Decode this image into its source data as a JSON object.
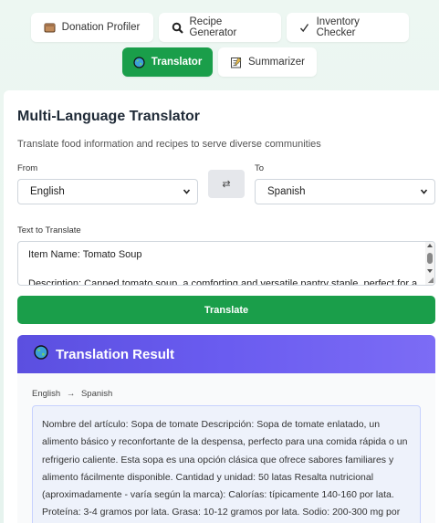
{
  "nav": {
    "tabs": [
      {
        "label": "Donation Profiler",
        "icon": "box-icon",
        "active": false
      },
      {
        "label": "Recipe Generator",
        "icon": "search-icon",
        "active": false
      },
      {
        "label": "Inventory Checker",
        "icon": "checkmark-icon",
        "active": false
      },
      {
        "label": "Translator",
        "icon": "globe-icon",
        "active": true
      },
      {
        "label": "Summarizer",
        "icon": "memo-icon",
        "active": false
      }
    ]
  },
  "card": {
    "title": "Multi-Language Translator",
    "subtitle": "Translate food information and recipes to serve diverse communities",
    "from_label": "From",
    "from_value": "English",
    "to_label": "To",
    "to_value": "Spanish",
    "swap_symbol": "⇄",
    "text_label": "Text to Translate",
    "input_line1": "Item Name: Tomato Soup",
    "input_line2": "Description: Canned tomato soup, a comforting and versatile pantry staple, perfect for a",
    "translate_button": "Translate"
  },
  "result": {
    "title": "Translation Result",
    "source_lang": "English",
    "arrow": "→",
    "target_lang": "Spanish",
    "text": "Nombre del artículo: Sopa de tomate Descripción: Sopa de tomate enlatado, un alimento básico y reconfortante de la despensa, perfecto para una comida rápida o un refrigerio caliente. Esta sopa es una opción clásica que ofrece sabores familiares y alimento fácilmente disponible. Cantidad y unidad: 50 latas Resalta nutricional (aproximadamente - varía según la marca): Calorías: típicamente 140-160 por lata. Proteína: 3-4 gramos por lata. Grasa: 10-12 gramos por lata. Sodio: 200-300 mg por"
  },
  "colors": {
    "accent_green": "#1a9e4a",
    "result_header": "#6a5cf0"
  }
}
